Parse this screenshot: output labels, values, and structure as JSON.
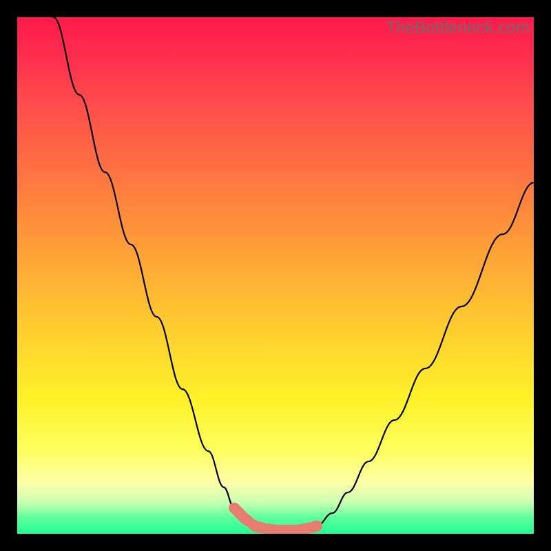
{
  "watermark": "TheBottleneck.com",
  "chart_data": {
    "type": "line",
    "title": "",
    "xlabel": "",
    "ylabel": "",
    "xlim": [
      0,
      100
    ],
    "ylim": [
      0,
      100
    ],
    "grid": false,
    "legend": false,
    "series": [
      {
        "name": "left-curve",
        "x": [
          7,
          12,
          17,
          22,
          27,
          32,
          37,
          40,
          42,
          44,
          46,
          48
        ],
        "y": [
          100,
          85,
          70,
          56,
          42,
          28,
          16,
          9,
          5,
          3,
          1.5,
          1
        ]
      },
      {
        "name": "bottom-flat",
        "x": [
          48,
          50,
          52,
          54,
          56,
          58
        ],
        "y": [
          1,
          0.7,
          0.7,
          0.7,
          1,
          1.5
        ]
      },
      {
        "name": "right-curve",
        "x": [
          58,
          61,
          64,
          68,
          73,
          79,
          86,
          94,
          100
        ],
        "y": [
          1.5,
          4,
          8,
          14,
          22,
          32,
          44,
          58,
          68
        ]
      }
    ],
    "highlight_band": {
      "description": "thick salmon segment near curve bottom",
      "color": "#e77d71",
      "x_range": [
        41,
        60
      ],
      "y_approx": 2
    },
    "background_gradient": {
      "stops": [
        {
          "pos": 0,
          "color": "#ff1a4a"
        },
        {
          "pos": 50,
          "color": "#ffaf35"
        },
        {
          "pos": 78,
          "color": "#fff22a"
        },
        {
          "pos": 97,
          "color": "#5cff9c"
        },
        {
          "pos": 100,
          "color": "#1fff94"
        }
      ]
    }
  }
}
